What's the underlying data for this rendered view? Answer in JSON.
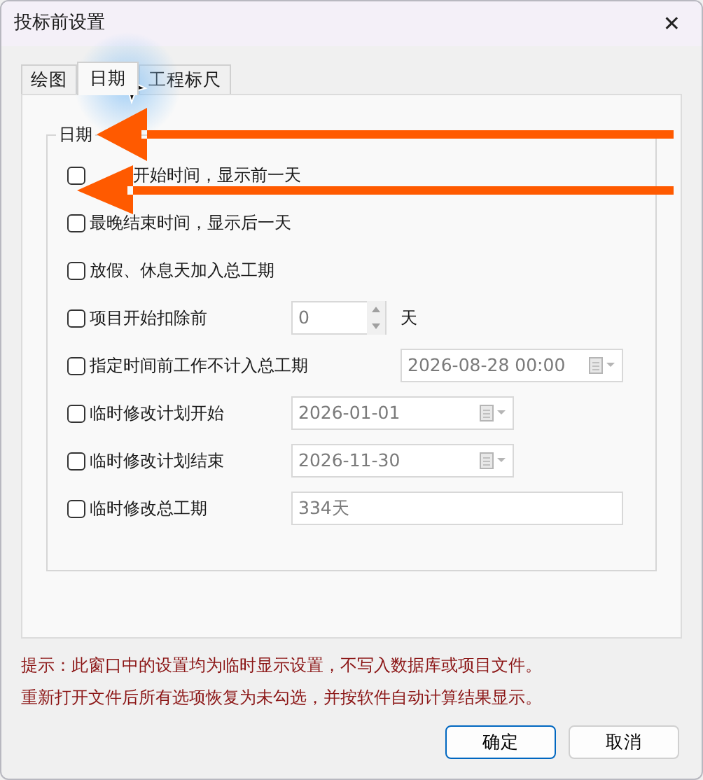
{
  "window": {
    "title": "投标前设置",
    "close": "✕"
  },
  "tabs": [
    {
      "label": "绘图",
      "selected": false
    },
    {
      "label": "日期",
      "selected": true
    },
    {
      "label": "工程标尺",
      "selected": false
    }
  ],
  "group": {
    "title": "日期",
    "options": [
      {
        "kind": "covered",
        "label": "开始时间，显示前一天",
        "checked": false
      },
      {
        "kind": "plain",
        "label": "最晚结束时间，显示后一天",
        "checked": false
      },
      {
        "kind": "plain",
        "label": "放假、休息天加入总工期",
        "checked": false
      },
      {
        "kind": "spin",
        "label": "项目开始扣除前",
        "checked": false,
        "value": "0",
        "unit": "天"
      },
      {
        "kind": "datetime",
        "label": "指定时间前工作不计入总工期",
        "checked": false,
        "value": "2026-08-28 00:00"
      },
      {
        "kind": "date",
        "label": "临时修改计划开始",
        "checked": false,
        "value": "2026-01-01"
      },
      {
        "kind": "date",
        "label": "临时修改计划结束",
        "checked": false,
        "value": "2026-11-30"
      },
      {
        "kind": "text",
        "label": "临时修改总工期",
        "checked": false,
        "value": "334天"
      }
    ]
  },
  "notes": [
    "提示：此窗口中的设置均为临时显示设置，不写入数据库或项目文件。",
    "重新打开文件后所有选项恢复为未勾选，并按软件自动计算结果显示。"
  ],
  "buttons": [
    {
      "label": "确定",
      "default": true
    },
    {
      "label": "取消",
      "default": false
    }
  ]
}
